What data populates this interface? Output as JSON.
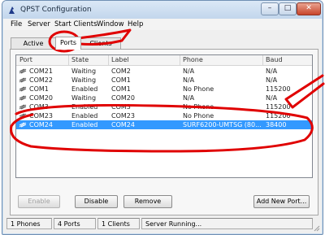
{
  "window": {
    "title": "QPST Configuration",
    "min_glyph": "–",
    "max_glyph": "□",
    "close_glyph": "✕"
  },
  "menu": [
    "File",
    "Server",
    "Start Clients",
    "Window",
    "Help"
  ],
  "tabs": [
    {
      "label": "Active Phones",
      "active": false
    },
    {
      "label": "Ports",
      "active": true
    },
    {
      "label": "Clients",
      "active": false
    }
  ],
  "columns": [
    "Port",
    "State",
    "Label",
    "Phone",
    "Baud"
  ],
  "rows": [
    {
      "port": "COM21",
      "state": "Waiting",
      "label": "COM2",
      "phone": "N/A",
      "baud": "N/A",
      "selected": false
    },
    {
      "port": "COM22",
      "state": "Waiting",
      "label": "COM1",
      "phone": "N/A",
      "baud": "N/A",
      "selected": false
    },
    {
      "port": "COM1",
      "state": "Enabled",
      "label": "COM1",
      "phone": "No Phone",
      "baud": "115200",
      "selected": false
    },
    {
      "port": "COM20",
      "state": "Waiting",
      "label": "COM20",
      "phone": "N/A",
      "baud": "N/A",
      "selected": false
    },
    {
      "port": "COM3",
      "state": "Enabled",
      "label": "COM3",
      "phone": "No Phone",
      "baud": "115200",
      "selected": false
    },
    {
      "port": "COM23",
      "state": "Enabled",
      "label": "COM23",
      "phone": "No Phone",
      "baud": "115200",
      "selected": false
    },
    {
      "port": "COM24",
      "state": "Enabled",
      "label": "COM24",
      "phone": "SURF6200-UMTSG (80...",
      "baud": "38400",
      "selected": true
    }
  ],
  "buttons": {
    "enable": "Enable",
    "disable": "Disable",
    "remove": "Remove",
    "add_new_port": "Add New Port..."
  },
  "status": [
    "1 Phones",
    "4 Ports",
    "1 Clients",
    "Server Running..."
  ],
  "colors": {
    "selection": "#3399ff",
    "annotation": "#e00000",
    "titlebar": "#c9dcef"
  },
  "icons": {
    "port_row": "phone-port-icon",
    "app": "qpst-app-icon"
  }
}
